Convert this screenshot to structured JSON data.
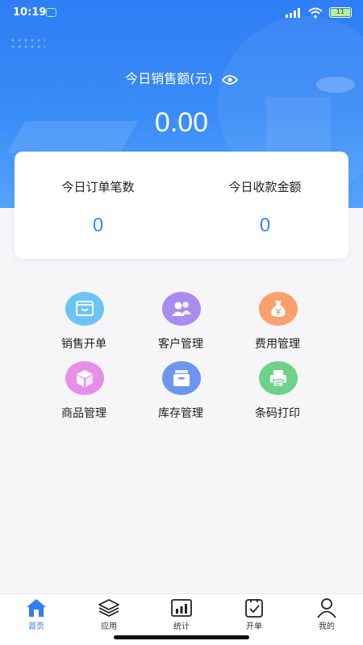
{
  "status_bar": {
    "time": "10:19",
    "battery": "11"
  },
  "header": {
    "sales_label": "今日销售额(元)",
    "sales_value": "0.00"
  },
  "stats": [
    {
      "label": "今日订单笔数",
      "value": "0"
    },
    {
      "label": "今日收款金额",
      "value": "0"
    }
  ],
  "menu": [
    {
      "label": "销售开单",
      "icon": "sales-order-icon",
      "color": "#6ec3f5"
    },
    {
      "label": "客户管理",
      "icon": "customers-icon",
      "color": "#a98cf0"
    },
    {
      "label": "费用管理",
      "icon": "money-bag-icon",
      "color": "#f9a06c"
    },
    {
      "label": "商品管理",
      "icon": "product-box-icon",
      "color": "#e78ee8"
    },
    {
      "label": "库存管理",
      "icon": "inventory-icon",
      "color": "#6d96f0"
    },
    {
      "label": "条码打印",
      "icon": "printer-icon",
      "color": "#6fd28a"
    }
  ],
  "tabbar": {
    "active": "首页",
    "items": [
      {
        "label": "首页",
        "icon": "home-icon"
      },
      {
        "label": "应用",
        "icon": "layers-icon"
      },
      {
        "label": "统计",
        "icon": "chart-icon"
      },
      {
        "label": "开单",
        "icon": "order-icon"
      },
      {
        "label": "我的",
        "icon": "profile-icon"
      }
    ]
  },
  "colors": {
    "primary": "#2f7ef5",
    "stat_value": "#3a88e8"
  }
}
